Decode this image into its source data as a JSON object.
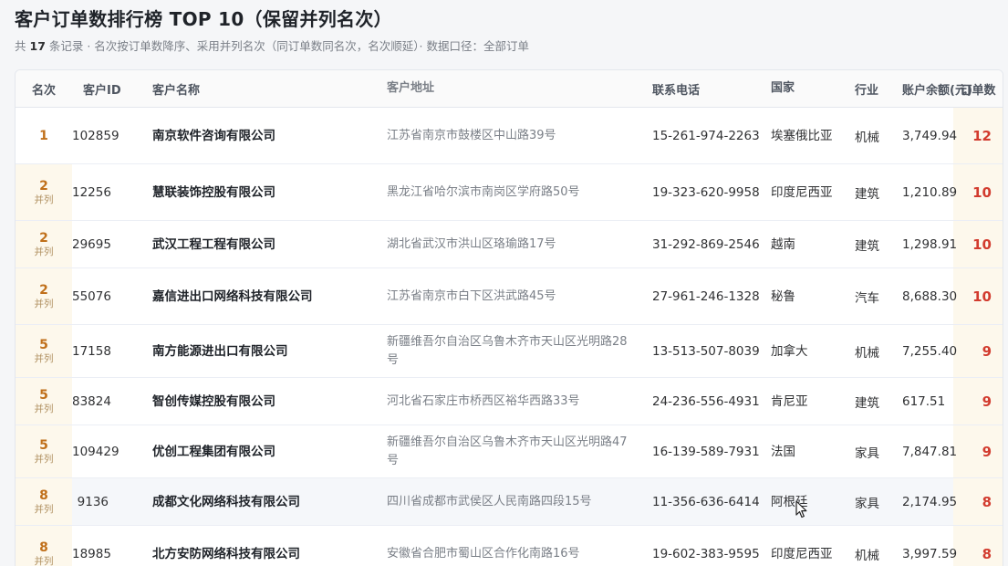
{
  "title": "客户订单数排行榜 TOP 10（保留并列名次）",
  "subtitle": {
    "prefix": "共",
    "count": "17",
    "suffix": "条记录 · 名次按订单数降序、采用并列名次（同订单数同名次，名次顺延）· 数据口径：全部订单"
  },
  "columns": {
    "rank": "名次",
    "id": "客户ID",
    "name": "客户名称",
    "address": "客户地址",
    "phone": "联系电话",
    "country": "国家",
    "industry": "行业",
    "balance": "账户余额(元)",
    "orders": "订单数"
  },
  "tie_label": "并列",
  "rows": [
    {
      "rank": "1",
      "tie": "",
      "id": "102859",
      "name": "南京软件咨询有限公司",
      "address": "江苏省南京市鼓楼区中山路39号",
      "phone": "15-261-974-2263",
      "country": "埃塞俄比亚",
      "industry": "机械",
      "balance": "3,749.94",
      "orders": "12"
    },
    {
      "rank": "2",
      "tie": "并列",
      "id": "12256",
      "name": "慧联装饰控股有限公司",
      "address": "黑龙江省哈尔滨市南岗区学府路50号",
      "phone": "19-323-620-9958",
      "country": "印度尼西亚",
      "industry": "建筑",
      "balance": "1,210.89",
      "orders": "10"
    },
    {
      "rank": "2",
      "tie": "并列",
      "id": "29695",
      "name": "武汉工程工程有限公司",
      "address": "湖北省武汉市洪山区珞瑜路17号",
      "phone": "31-292-869-2546",
      "country": "越南",
      "industry": "建筑",
      "balance": "1,298.91",
      "orders": "10"
    },
    {
      "rank": "2",
      "tie": "并列",
      "id": "55076",
      "name": "嘉信进出口网络科技有限公司",
      "address": "江苏省南京市白下区洪武路45号",
      "phone": "27-961-246-1328",
      "country": "秘鲁",
      "industry": "汽车",
      "balance": "8,688.30",
      "orders": "10"
    },
    {
      "rank": "5",
      "tie": "并列",
      "id": "17158",
      "name": "南方能源进出口有限公司",
      "address": "新疆维吾尔自治区乌鲁木齐市天山区光明路28号",
      "phone": "13-513-507-8039",
      "country": "加拿大",
      "industry": "机械",
      "balance": "7,255.40",
      "orders": "9"
    },
    {
      "rank": "5",
      "tie": "并列",
      "id": "83824",
      "name": "智创传媒控股有限公司",
      "address": "河北省石家庄市桥西区裕华西路33号",
      "phone": "24-236-556-4931",
      "country": "肯尼亚",
      "industry": "建筑",
      "balance": "617.51",
      "orders": "9"
    },
    {
      "rank": "5",
      "tie": "并列",
      "id": "109429",
      "name": "优创工程集团有限公司",
      "address": "新疆维吾尔自治区乌鲁木齐市天山区光明路47号",
      "phone": "16-139-589-7931",
      "country": "法国",
      "industry": "家具",
      "balance": "7,847.81",
      "orders": "9"
    },
    {
      "rank": "8",
      "tie": "并列",
      "id": "9136",
      "name": "成都文化网络科技有限公司",
      "address": "四川省成都市武侯区人民南路四段15号",
      "phone": "11-356-636-6414",
      "country": "阿根廷",
      "industry": "家具",
      "balance": "2,174.95",
      "orders": "8"
    },
    {
      "rank": "8",
      "tie": "并列",
      "id": "18985",
      "name": "北方安防网络科技有限公司",
      "address": "安徽省合肥市蜀山区合作化南路16号",
      "phone": "19-602-383-9595",
      "country": "印度尼西亚",
      "industry": "机械",
      "balance": "3,997.59",
      "orders": "8"
    }
  ],
  "colors": {
    "rank": "#c0701b",
    "orders": "#d23b2e",
    "tie_background": "#fdf8ec"
  }
}
